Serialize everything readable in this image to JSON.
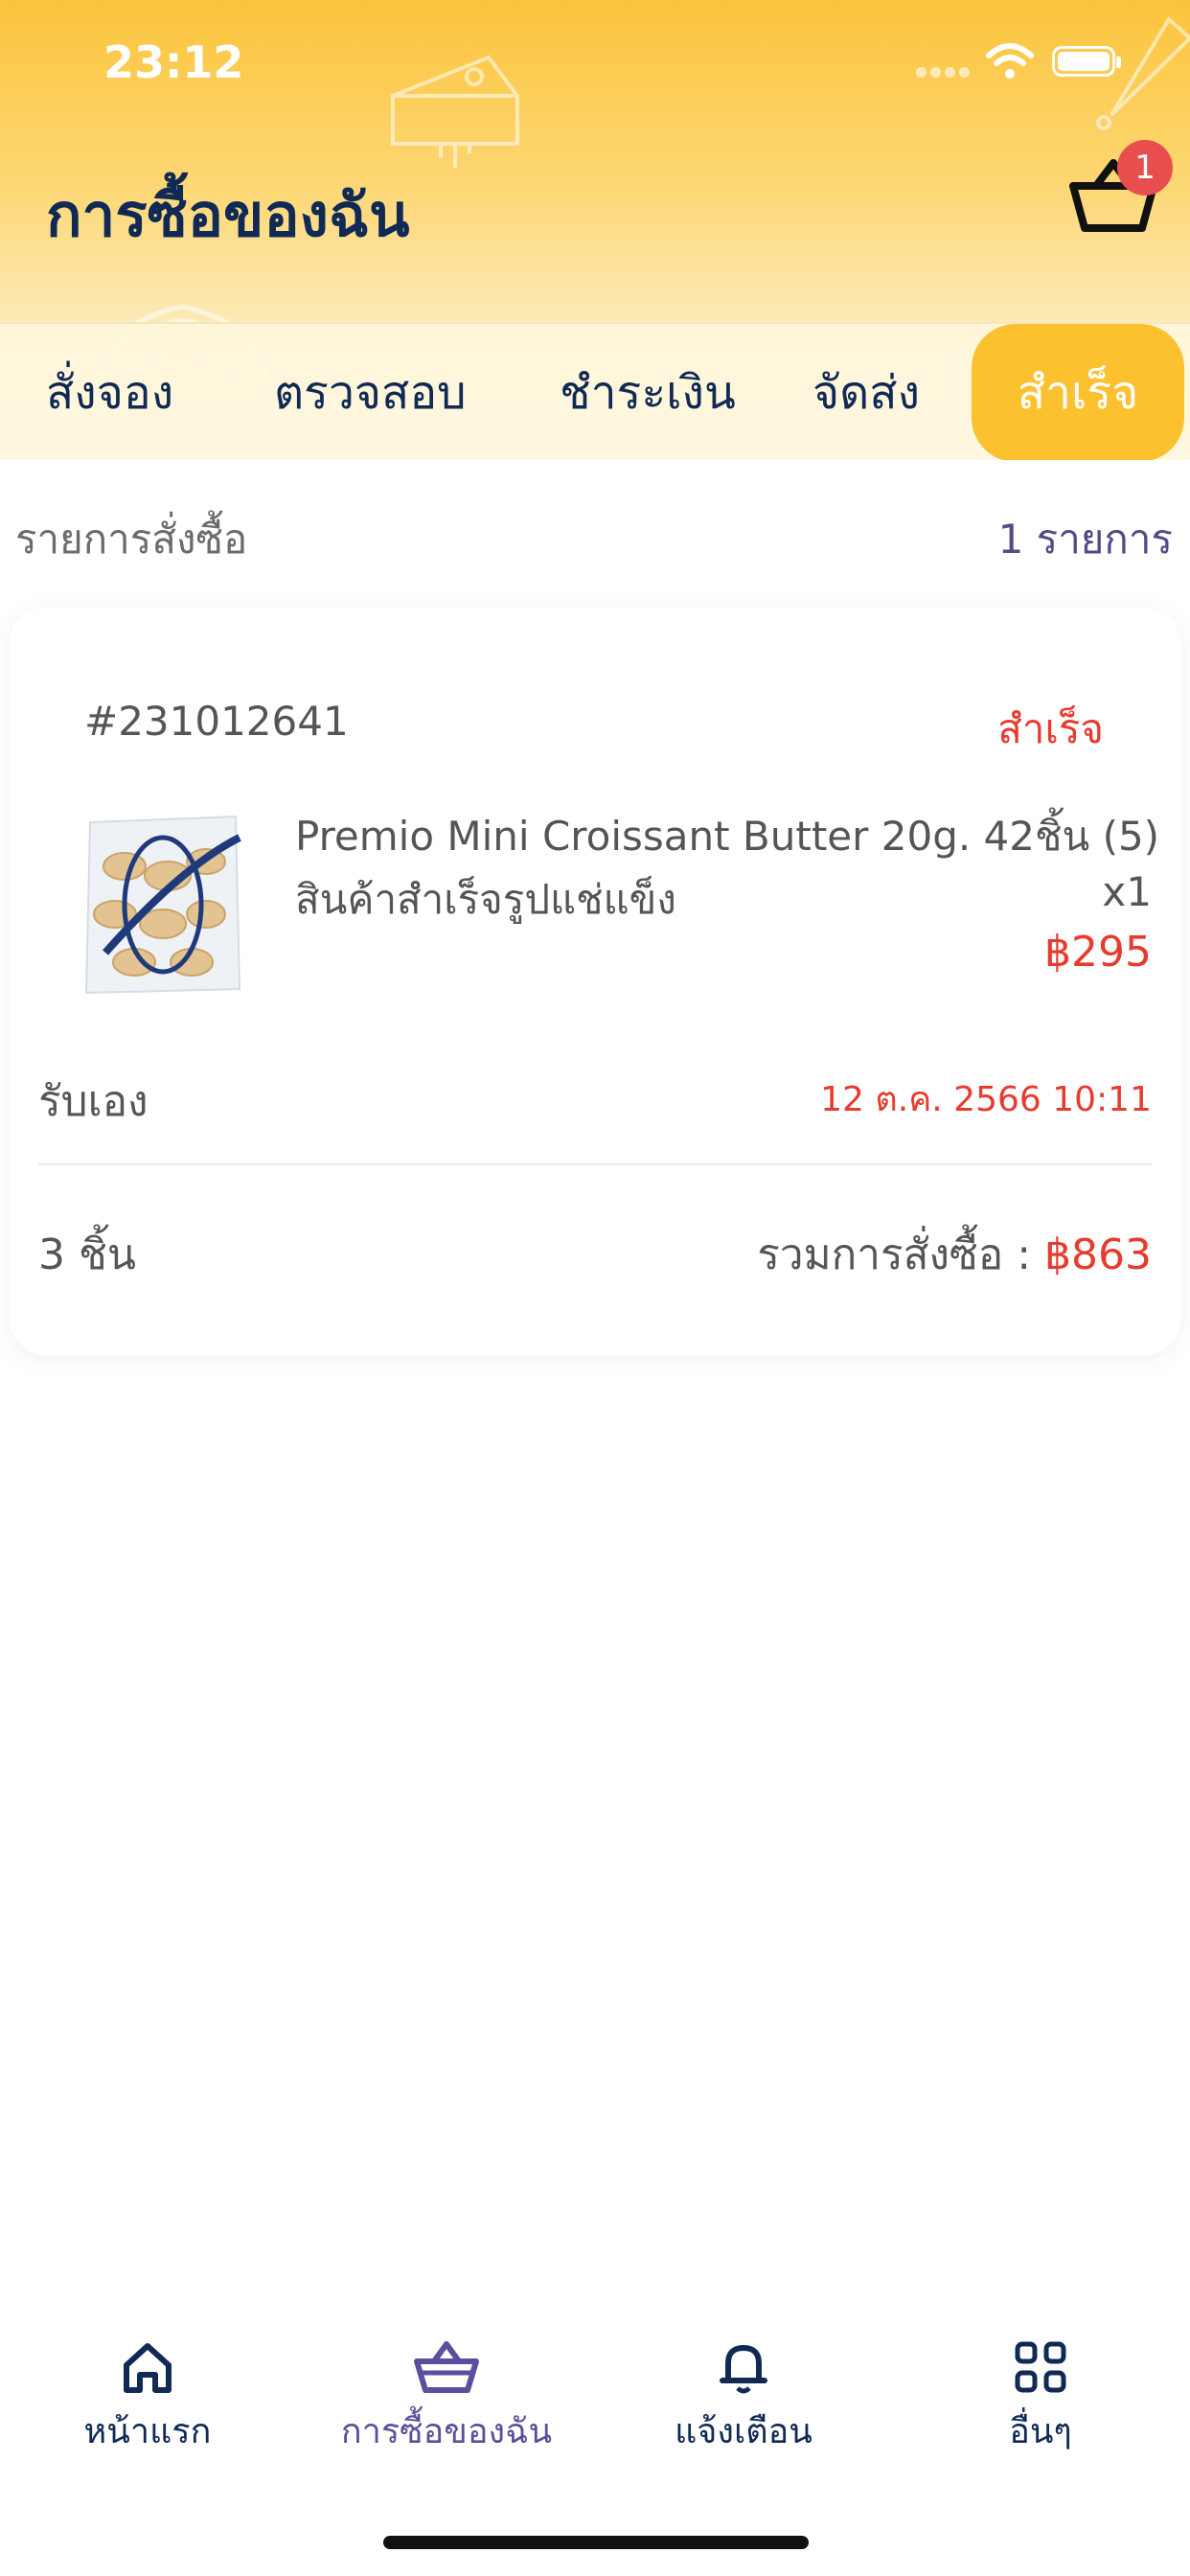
{
  "status_bar": {
    "time": "23:12"
  },
  "header": {
    "title": "การซื้อของฉัน",
    "cart_badge": "1"
  },
  "tabs": [
    {
      "label": "สั่งจอง"
    },
    {
      "label": "ตรวจสอบ"
    },
    {
      "label": "ชำระเงิน"
    },
    {
      "label": "จัดส่ง"
    },
    {
      "label": "สำเร็จ",
      "active": true
    }
  ],
  "list_header": {
    "title": "รายการสั่งซื้อ",
    "count": "1 รายการ"
  },
  "order": {
    "number": "#231012641",
    "status": "สำเร็จ",
    "product": {
      "name": "Premio Mini Croissant Butter 20g. 42ชิ้น (5)",
      "category": "สินค้าสำเร็จรูปแช่แข็ง",
      "quantity": "x1",
      "price": "฿295"
    },
    "delivery_method": "รับเอง",
    "date": "12 ต.ค. 2566 10:11",
    "items_count": "3 ชิ้น",
    "total_label": "รวมการสั่งซื้อ : ",
    "total_value": "฿863"
  },
  "bottom_nav": [
    {
      "label": "หน้าแรก",
      "icon": "home-icon"
    },
    {
      "label": "การซื้อของฉัน",
      "icon": "basket-icon",
      "active": true
    },
    {
      "label": "แจ้งเตือน",
      "icon": "bell-icon"
    },
    {
      "label": "อื่นๆ",
      "icon": "grid-icon"
    }
  ],
  "colors": {
    "header_yellow": "#fcc43c",
    "active_tab": "#fcc12e",
    "navy": "#102a55",
    "accent_red": "#e83a2d",
    "nav_active": "#5a4f9c"
  }
}
